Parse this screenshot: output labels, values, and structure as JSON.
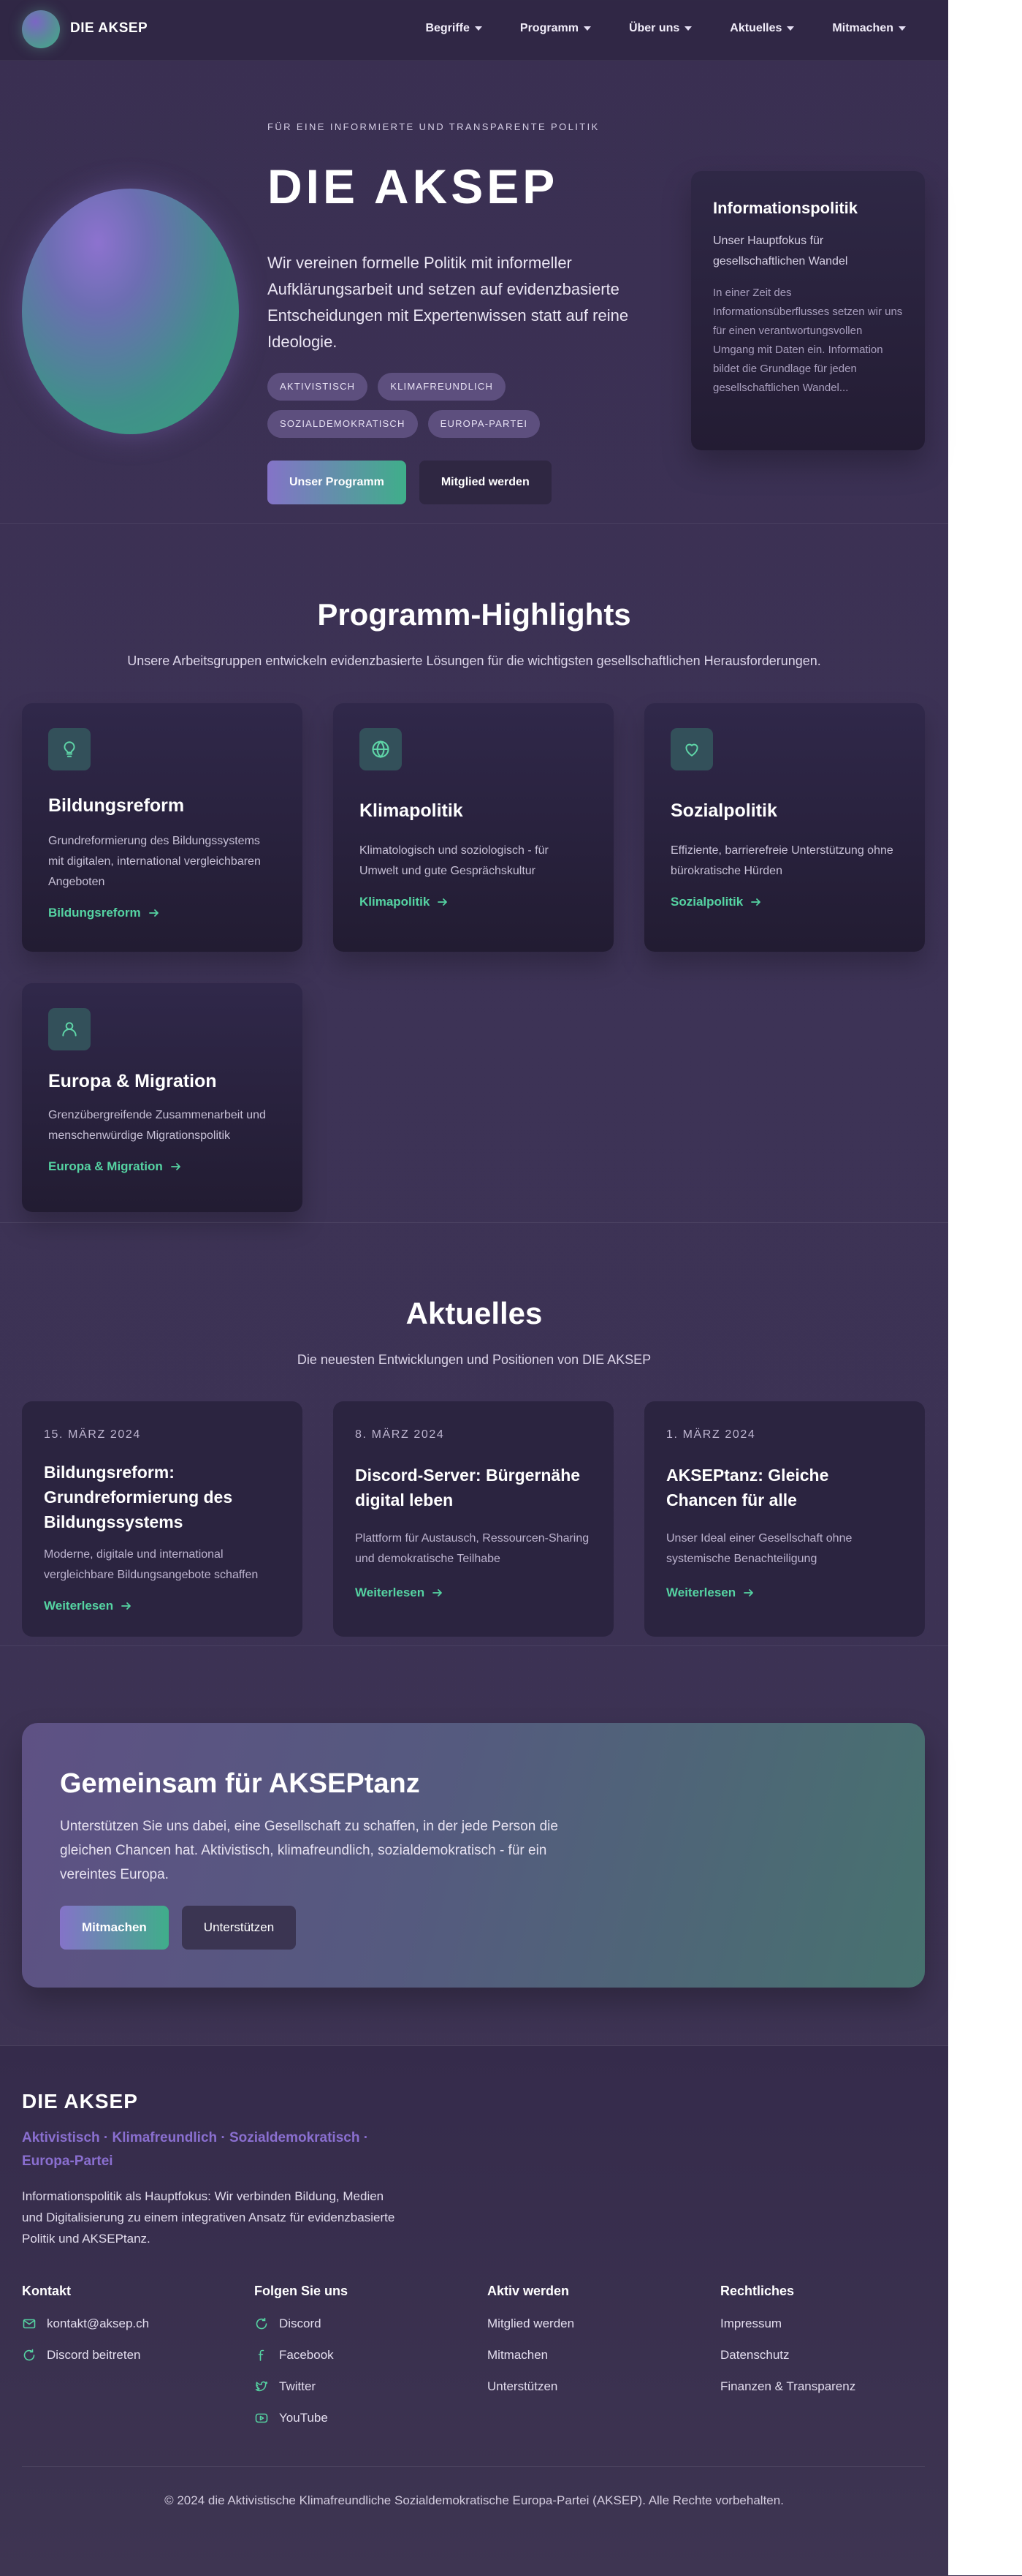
{
  "nav": {
    "brand": "DIE AKSEP",
    "items": [
      {
        "label": "Begriffe"
      },
      {
        "label": "Programm"
      },
      {
        "label": "Über uns"
      },
      {
        "label": "Aktuelles"
      },
      {
        "label": "Mitmachen"
      }
    ]
  },
  "hero": {
    "eyebrow": "FÜR EINE INFORMIERTE UND TRANSPARENTE POLITIK",
    "title": "DIE AKSEP",
    "description": "Wir vereinen formelle Politik mit informeller Aufklärungsarbeit und setzen auf evidenzbasierte Entscheidungen mit Expertenwissen statt auf reine Ideologie.",
    "tags": [
      "AKTIVISTISCH",
      "KLIMAFREUNDLICH",
      "SOZIALDEMOKRATISCH",
      "EUROPA-PARTEI"
    ],
    "primary_button": "Unser Programm",
    "secondary_button": "Mitglied werden"
  },
  "info_card": {
    "title": "Informationspolitik",
    "lead": "Unser Hauptfokus für gesellschaftlichen Wandel",
    "body": "In einer Zeit des Informationsüberflusses setzen wir uns für einen verantwortungsvollen Umgang mit Daten ein. Information bildet die Grundlage für jeden gesellschaftlichen Wandel..."
  },
  "highlights": {
    "title": "Programm-Highlights",
    "subtitle": "Unsere Arbeitsgruppen entwickeln evidenzbasierte Lösungen für die wichtigsten gesellschaftlichen Herausforderungen.",
    "cards": [
      {
        "icon": "lightbulb-icon",
        "title": "Bildungsreform",
        "text": "Grundreformierung des Bildungssystems mit digitalen, international vergleichbaren Angeboten",
        "link": "Bildungsreform"
      },
      {
        "icon": "globe-icon",
        "title": "Klimapolitik",
        "text": "Klimatologisch und soziologisch - für Umwelt und gute Gesprächskultur",
        "link": "Klimapolitik"
      },
      {
        "icon": "heart-icon",
        "title": "Sozialpolitik",
        "text": "Effiziente, barrierefreie Unterstützung ohne bürokratische Hürden",
        "link": "Sozialpolitik"
      },
      {
        "icon": "person-icon",
        "title": "Europa & Migration",
        "text": "Grenzübergreifende Zusammenarbeit und menschenwürdige Migrationspolitik",
        "link": "Europa & Migration"
      }
    ]
  },
  "news": {
    "title": "Aktuelles",
    "subtitle": "Die neuesten Entwicklungen und Positionen von DIE AKSEP",
    "items": [
      {
        "date": "15. MÄRZ 2024",
        "title": "Bildungsreform: Grundreformierung des Bildungssystems",
        "text": "Moderne, digitale und international vergleichbare Bildungsangebote schaffen",
        "link": "Weiterlesen"
      },
      {
        "date": "8. MÄRZ 2024",
        "title": "Discord-Server: Bürgernähe digital leben",
        "text": "Plattform für Austausch, Ressourcen-Sharing und demokratische Teilhabe",
        "link": "Weiterlesen"
      },
      {
        "date": "1. MÄRZ 2024",
        "title": "AKSEPtanz: Gleiche Chancen für alle",
        "text": "Unser Ideal einer Gesellschaft ohne systemische Benachteiligung",
        "link": "Weiterlesen"
      }
    ]
  },
  "cta": {
    "title": "Gemeinsam für AKSEPtanz",
    "text": "Unterstützen Sie uns dabei, eine Gesellschaft zu schaffen, in der jede Person die gleichen Chancen hat. Aktivistisch, klimafreundlich, sozialdemokratisch - für ein vereintes Europa.",
    "primary_button": "Mitmachen",
    "secondary_button": "Unterstützen"
  },
  "footer": {
    "brand": "DIE AKSEP",
    "tagline": "Aktivistisch · Klimafreundlich · Sozialdemokratisch · Europa-Partei",
    "description": "Informationspolitik als Hauptfokus: Wir verbinden Bildung, Medien und Digitalisierung zu einem integrativen Ansatz für evidenzbasierte Politik und AKSEPtanz.",
    "contact": {
      "title": "Kontakt",
      "email": "kontakt@aksep.ch",
      "discord": "Discord beitreten"
    },
    "social": {
      "title": "Folgen Sie uns",
      "items": [
        "Discord",
        "Facebook",
        "Twitter",
        "YouTube"
      ]
    },
    "active": {
      "title": "Aktiv werden",
      "items": [
        "Mitglied werden",
        "Mitmachen",
        "Unterstützen"
      ]
    },
    "legal": {
      "title": "Rechtliches",
      "items": [
        "Impressum",
        "Datenschutz",
        "Finanzen & Transparenz"
      ]
    },
    "copyright": "© 2024 die Aktivistische Klimafreundliche Sozialdemokratische Europa-Partei (AKSEP). Alle Rechte vorbehalten."
  },
  "colors": {
    "accent_green": "#55d3a2",
    "accent_purple": "#8a6fd0",
    "background": "#3c3253"
  }
}
